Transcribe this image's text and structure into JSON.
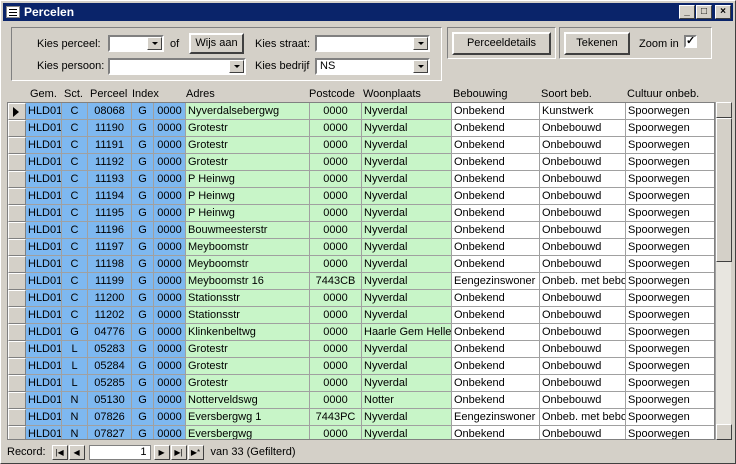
{
  "window": {
    "title": "Percelen"
  },
  "filters": {
    "kies_perceel_label": "Kies perceel:",
    "kies_perceel_value": "",
    "of_label": "of",
    "wijs_aan_label": "Wijs aan",
    "kies_straat_label": "Kies straat:",
    "kies_straat_value": "",
    "kies_persoon_label": "Kies persoon:",
    "kies_persoon_value": "",
    "kies_bedrijf_label": "Kies bedrijf",
    "kies_bedrijf_value": "NS"
  },
  "actions": {
    "perceeldetails_label": "Perceeldetails",
    "tekenen_label": "Tekenen",
    "zoom_in_label": "Zoom in",
    "zoom_in_checked": "✓"
  },
  "columns": [
    "Gem.",
    "Sct.",
    "Perceel",
    "Index",
    "Adres",
    "Postcode",
    "Woonplaats",
    "Bebouwing",
    "Soort beb.",
    "Cultuur onbeb."
  ],
  "rows": [
    [
      "HLD01",
      "C",
      "08068",
      "G",
      "0000",
      "Nyverdalsebergwg",
      "0000",
      "Nyverdal",
      "Onbekend",
      "Kunstwerk",
      "Spoorwegen"
    ],
    [
      "HLD01",
      "C",
      "11190",
      "G",
      "0000",
      "Grotestr",
      "0000",
      "Nyverdal",
      "Onbekend",
      "Onbebouwd",
      "Spoorwegen"
    ],
    [
      "HLD01",
      "C",
      "11191",
      "G",
      "0000",
      "Grotestr",
      "0000",
      "Nyverdal",
      "Onbekend",
      "Onbebouwd",
      "Spoorwegen"
    ],
    [
      "HLD01",
      "C",
      "11192",
      "G",
      "0000",
      "Grotestr",
      "0000",
      "Nyverdal",
      "Onbekend",
      "Onbebouwd",
      "Spoorwegen"
    ],
    [
      "HLD01",
      "C",
      "11193",
      "G",
      "0000",
      "P Heinwg",
      "0000",
      "Nyverdal",
      "Onbekend",
      "Onbebouwd",
      "Spoorwegen"
    ],
    [
      "HLD01",
      "C",
      "11194",
      "G",
      "0000",
      "P Heinwg",
      "0000",
      "Nyverdal",
      "Onbekend",
      "Onbebouwd",
      "Spoorwegen"
    ],
    [
      "HLD01",
      "C",
      "11195",
      "G",
      "0000",
      "P Heinwg",
      "0000",
      "Nyverdal",
      "Onbekend",
      "Onbebouwd",
      "Spoorwegen"
    ],
    [
      "HLD01",
      "C",
      "11196",
      "G",
      "0000",
      "Bouwmeesterstr",
      "0000",
      "Nyverdal",
      "Onbekend",
      "Onbebouwd",
      "Spoorwegen"
    ],
    [
      "HLD01",
      "C",
      "11197",
      "G",
      "0000",
      "Meyboomstr",
      "0000",
      "Nyverdal",
      "Onbekend",
      "Onbebouwd",
      "Spoorwegen"
    ],
    [
      "HLD01",
      "C",
      "11198",
      "G",
      "0000",
      "Meyboomstr",
      "0000",
      "Nyverdal",
      "Onbekend",
      "Onbebouwd",
      "Spoorwegen"
    ],
    [
      "HLD01",
      "C",
      "11199",
      "G",
      "0000",
      "Meyboomstr 16",
      "7443CB",
      "Nyverdal",
      "Eengezinswoner",
      "Onbeb. met bebo",
      "Spoorwegen"
    ],
    [
      "HLD01",
      "C",
      "11200",
      "G",
      "0000",
      "Stationsstr",
      "0000",
      "Nyverdal",
      "Onbekend",
      "Onbebouwd",
      "Spoorwegen"
    ],
    [
      "HLD01",
      "C",
      "11202",
      "G",
      "0000",
      "Stationsstr",
      "0000",
      "Nyverdal",
      "Onbekend",
      "Onbebouwd",
      "Spoorwegen"
    ],
    [
      "HLD01",
      "G",
      "04776",
      "G",
      "0000",
      "Klinkenbeltwg",
      "0000",
      "Haarle Gem Hellen",
      "Onbekend",
      "Onbebouwd",
      "Spoorwegen"
    ],
    [
      "HLD01",
      "L",
      "05283",
      "G",
      "0000",
      "Grotestr",
      "0000",
      "Nyverdal",
      "Onbekend",
      "Onbebouwd",
      "Spoorwegen"
    ],
    [
      "HLD01",
      "L",
      "05284",
      "G",
      "0000",
      "Grotestr",
      "0000",
      "Nyverdal",
      "Onbekend",
      "Onbebouwd",
      "Spoorwegen"
    ],
    [
      "HLD01",
      "L",
      "05285",
      "G",
      "0000",
      "Grotestr",
      "0000",
      "Nyverdal",
      "Onbekend",
      "Onbebouwd",
      "Spoorwegen"
    ],
    [
      "HLD01",
      "N",
      "05130",
      "G",
      "0000",
      "Notterveldswg",
      "0000",
      "Notter",
      "Onbekend",
      "Onbebouwd",
      "Spoorwegen"
    ],
    [
      "HLD01",
      "N",
      "07826",
      "G",
      "0000",
      "Eversbergwg 1",
      "7443PC",
      "Nyverdal",
      "Eengezinswoner",
      "Onbeb. met bebo",
      "Spoorwegen"
    ],
    [
      "HLD01",
      "N",
      "07827",
      "G",
      "0000",
      "Eversbergwg",
      "0000",
      "Nyverdal",
      "Onbekend",
      "Onbebouwd",
      "Spoorwegen"
    ]
  ],
  "navigation": {
    "record_label": "Record:",
    "current_record": "1",
    "total_text": "van  33 (Gefilterd)"
  }
}
